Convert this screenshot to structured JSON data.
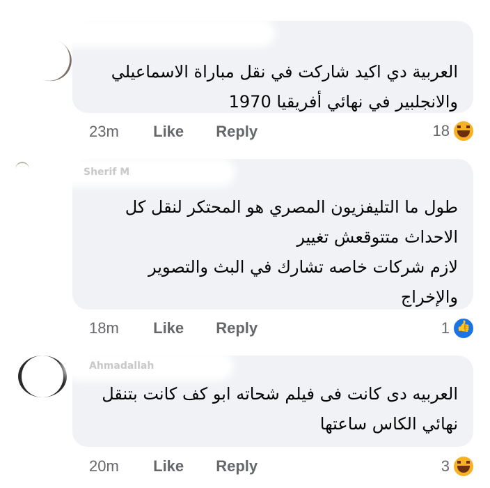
{
  "comments": [
    {
      "author": "",
      "text_lines": [
        "العربية دي اكيد شاركت في نقل مباراة الاسماعيلي",
        "والانجلبير في نهائي أفريقيا 1970"
      ],
      "time": "23m",
      "like_label": "Like",
      "reply_label": "Reply",
      "reaction_count": "18",
      "reaction_icon": "haha-emoji-icon"
    },
    {
      "author": "Sherif M",
      "text_lines": [
        "طول ما التليفزيون المصري هو المحتكر لنقل كل",
        "الاحداث متتوقعش تغيير",
        "لازم شركات خاصه تشارك في البث والتصوير",
        "والإخراج"
      ],
      "time": "18m",
      "like_label": "Like",
      "reply_label": "Reply",
      "reaction_count": "1",
      "reaction_icon": "like-thumb-icon"
    },
    {
      "author": "Ahmadallah",
      "text_lines": [
        "العربيه دى كانت فى فيلم شحاته ابو كف كانت بتنقل",
        "نهائي الكاس ساعتها"
      ],
      "time": "20m",
      "like_label": "Like",
      "reply_label": "Reply",
      "reaction_count": "3",
      "reaction_icon": "haha-emoji-icon"
    }
  ],
  "colors": {
    "bubble": "#f0f2f5",
    "meta_text": "#65676b",
    "like_blue": "#1b74e4",
    "haha_yellow": "#f7b125"
  }
}
